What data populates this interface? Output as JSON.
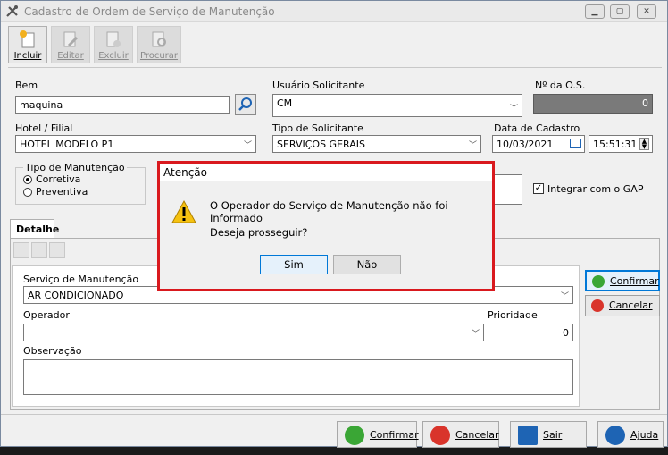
{
  "window": {
    "title": "Cadastro de Ordem de Serviço de Manutenção"
  },
  "toolbar": {
    "incluir": "Incluir",
    "editar": "Editar",
    "excluir": "Excluir",
    "procurar": "Procurar"
  },
  "form": {
    "bem_label": "Bem",
    "bem_value": "maquina",
    "usuario_label": "Usuário Solicitante",
    "usuario_value": "CM",
    "nos_label": "Nº da O.S.",
    "nos_value": "0",
    "hotel_label": "Hotel / Filial",
    "hotel_value": "HOTEL MODELO P1",
    "tipo_sol_label": "Tipo de Solicitante",
    "tipo_sol_value": "SERVIÇOS GERAIS",
    "data_label": "Data de Cadastro",
    "data_value": "10/03/2021",
    "hora_value": "15:51:31",
    "tipo_man_label": "Tipo de Manutenção",
    "corretiva": "Corretiva",
    "preventiva": "Preventiva",
    "integrar_label": "Integrar com o GAP"
  },
  "detalhe": {
    "tab": "Detalhe",
    "servico_label": "Serviço de Manutenção",
    "servico_value": "AR CONDICIONADO",
    "operador_label": "Operador",
    "operador_value": "",
    "prioridade_label": "Prioridade",
    "prioridade_value": "0",
    "observacao_label": "Observação",
    "confirmar": "Confirmar",
    "cancelar": "Cancelar"
  },
  "bottom": {
    "confirmar": "Confirmar",
    "cancelar": "Cancelar",
    "sair": "Sair",
    "ajuda": "Ajuda"
  },
  "dialog": {
    "title": "Atenção",
    "message": "O Operador do Serviço de Manutenção não foi Informado",
    "question": "Deseja prosseguir?",
    "sim": "Sim",
    "nao": "Não"
  },
  "colors": {
    "accent": "#0078d7",
    "dialog_border": "#d9191e",
    "ok_green": "#3aa635",
    "cancel_red": "#d9342b",
    "help_blue": "#1e64b4"
  }
}
